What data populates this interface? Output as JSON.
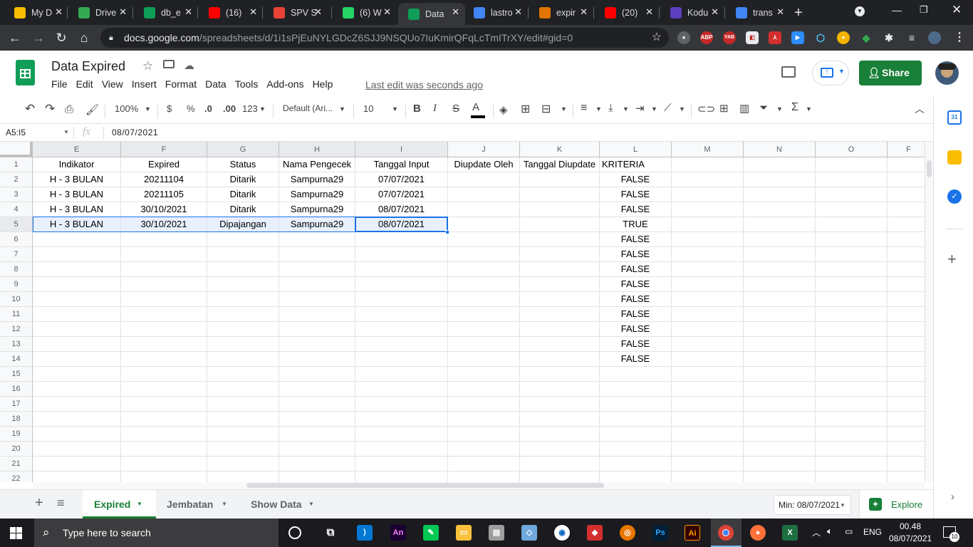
{
  "browser": {
    "tabs": [
      {
        "label": "My D",
        "icon": "drive-icon",
        "color": "#fbbc04"
      },
      {
        "label": "Drive",
        "icon": "drive-icon",
        "color": "#34a853"
      },
      {
        "label": "db_e",
        "icon": "sheets-icon",
        "color": "#0f9d58"
      },
      {
        "label": "(16)",
        "icon": "youtube-icon",
        "color": "#ff0000"
      },
      {
        "label": "SPV S",
        "icon": "gmail-icon",
        "color": "#ea4335"
      },
      {
        "label": "(6) W",
        "icon": "whatsapp-icon",
        "color": "#25d366"
      },
      {
        "label": "Data",
        "icon": "sheets-icon",
        "color": "#0f9d58"
      },
      {
        "label": "lastro",
        "icon": "google-icon",
        "color": "#4285f4"
      },
      {
        "label": "expir",
        "icon": "site-icon",
        "color": "#e37400"
      },
      {
        "label": "(20)",
        "icon": "youtube-icon",
        "color": "#ff0000"
      },
      {
        "label": "Kodu",
        "icon": "k-icon",
        "color": "#5b3fbf"
      },
      {
        "label": "trans",
        "icon": "google-icon",
        "color": "#4285f4"
      }
    ],
    "url_host": "docs.google.com",
    "url_path": "/spreadsheets/d/1i1sPjEuNYLGDcZ6SJJ9NSQUo7IuKmirQFqLcTmITrXY/edit#gid=0",
    "ext_abp": "ABP",
    "ext_yab": "YAB"
  },
  "doc": {
    "title": "Data Expired",
    "menu": [
      "File",
      "Edit",
      "View",
      "Insert",
      "Format",
      "Data",
      "Tools",
      "Add-ons",
      "Help"
    ],
    "last_edit": "Last edit was seconds ago",
    "share": "Share"
  },
  "toolbar": {
    "zoom": "100%",
    "currency": "$",
    "percent": "%",
    "dec_less": ".0",
    "dec_more": ".00",
    "more_formats": "123",
    "font": "Default (Ari...",
    "font_size": "10",
    "bold": "B",
    "italic": "I",
    "strike": "S",
    "textcolor": "A"
  },
  "formula_bar": {
    "name_box": "A5:I5",
    "fx": "fx",
    "value": "08/07/2021"
  },
  "grid": {
    "columns": [
      "E",
      "F",
      "G",
      "H",
      "I",
      "J",
      "K",
      "L",
      "M",
      "N",
      "O",
      "F"
    ],
    "rows": [
      "1",
      "2",
      "3",
      "4",
      "5",
      "6",
      "7",
      "8",
      "9",
      "10",
      "11",
      "12",
      "13",
      "14",
      "15",
      "16",
      "17",
      "18",
      "19",
      "20",
      "21",
      "22"
    ],
    "header_row": [
      "Indikator",
      "Expired",
      "Status",
      "Nama Pengecek",
      "Tanggal Input",
      "Diupdate Oleh",
      "Tanggal Diupdate",
      "KRITERIA"
    ],
    "data": [
      [
        "H - 3 BULAN",
        "20211104",
        "Ditarik",
        "Sampurna29",
        "07/07/2021",
        "",
        "",
        "FALSE"
      ],
      [
        "H - 3 BULAN",
        "20211105",
        "Ditarik",
        "Sampurna29",
        "07/07/2021",
        "",
        "",
        "FALSE"
      ],
      [
        "H - 3 BULAN",
        "30/10/2021",
        "Ditarik",
        "Sampurna29",
        "08/07/2021",
        "",
        "",
        "FALSE"
      ],
      [
        "H - 3 BULAN",
        "30/10/2021",
        "Dipajangan",
        "Sampurna29",
        "08/07/2021",
        "",
        "",
        "TRUE"
      ],
      [
        "",
        "",
        "",
        "",
        "",
        "",
        "",
        "FALSE"
      ],
      [
        "",
        "",
        "",
        "",
        "",
        "",
        "",
        "FALSE"
      ],
      [
        "",
        "",
        "",
        "",
        "",
        "",
        "",
        "FALSE"
      ],
      [
        "",
        "",
        "",
        "",
        "",
        "",
        "",
        "FALSE"
      ],
      [
        "",
        "",
        "",
        "",
        "",
        "",
        "",
        "FALSE"
      ],
      [
        "",
        "",
        "",
        "",
        "",
        "",
        "",
        "FALSE"
      ],
      [
        "",
        "",
        "",
        "",
        "",
        "",
        "",
        "FALSE"
      ],
      [
        "",
        "",
        "",
        "",
        "",
        "",
        "",
        "FALSE"
      ],
      [
        "",
        "",
        "",
        "",
        "",
        "",
        "",
        "FALSE"
      ]
    ]
  },
  "sheets": {
    "tabs": [
      "Expired",
      "Jembatan",
      "Show Data"
    ],
    "active": "Expired",
    "summary": "Min: 08/07/2021",
    "explore": "Explore"
  },
  "taskbar": {
    "search_placeholder": "Type here to search",
    "lang": "ENG",
    "time": "00.48",
    "date": "08/07/2021",
    "notifications": "10",
    "apps": [
      "An",
      "Ps",
      "Ai"
    ]
  }
}
